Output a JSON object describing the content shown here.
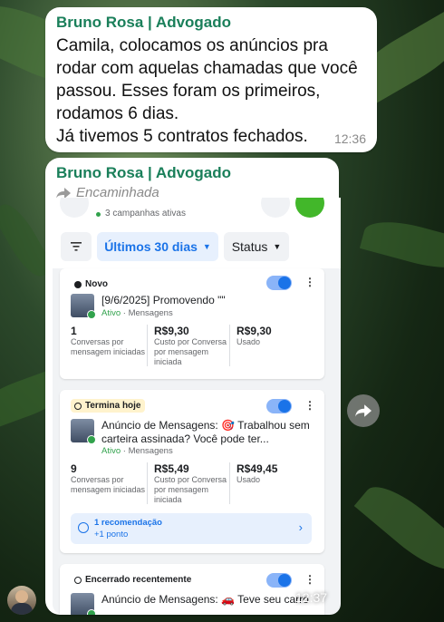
{
  "messages": [
    {
      "sender": "Bruno Rosa | Advogado",
      "lines": [
        "Camila, colocamos os anúncios pra",
        "rodar com aquelas chamadas que você",
        "passou. Esses foram os primeiros,",
        "rodamos 6 dias.",
        "Já tivemos 5 contratos fechados."
      ],
      "time": "12:36"
    },
    {
      "sender": "Bruno Rosa | Advogado",
      "forwarded_label": "Encaminhada",
      "time": "12:37"
    }
  ],
  "ads_manager": {
    "campaigns_active": "3 campanhas ativas",
    "filter_date": "Últimos 30 dias",
    "filter_status": "Status",
    "ads": [
      {
        "badge": "Novo",
        "title": "[9/6/2025] Promovendo \"\"",
        "status": "Ativo",
        "type": "Mensagens",
        "metrics": [
          {
            "value": "1",
            "label": "Conversas por mensagem iniciadas"
          },
          {
            "value": "R$9,30",
            "label": "Custo por Conversa por mensagem iniciada"
          },
          {
            "value": "R$9,30",
            "label": "Usado"
          }
        ]
      },
      {
        "badge": "Termina hoje",
        "title": "Anúncio de Mensagens: 🎯 Trabalhou sem carteira assinada? Você pode ter...",
        "title_lines": [
          "Anúncio de Mensagens: 🎯 Trabalhou sem",
          "carteira assinada? Você pode ter..."
        ],
        "status": "Ativo",
        "type": "Mensagens",
        "metrics": [
          {
            "value": "9",
            "label": "Conversas por mensagem iniciadas"
          },
          {
            "value": "R$5,49",
            "label": "Custo por Conversa por mensagem iniciada"
          },
          {
            "value": "R$49,45",
            "label": "Usado"
          }
        ],
        "recommendation": {
          "title": "1 recomendação",
          "points": "+1 ponto"
        }
      },
      {
        "badge": "Encerrado recentemente",
        "title": "Anúncio de Mensagens: 🚗 Teve seu carro"
      }
    ]
  },
  "colors": {
    "sender": "#1a7f5a",
    "accent_blue": "#1a73e8",
    "active_green": "#31a24c"
  }
}
